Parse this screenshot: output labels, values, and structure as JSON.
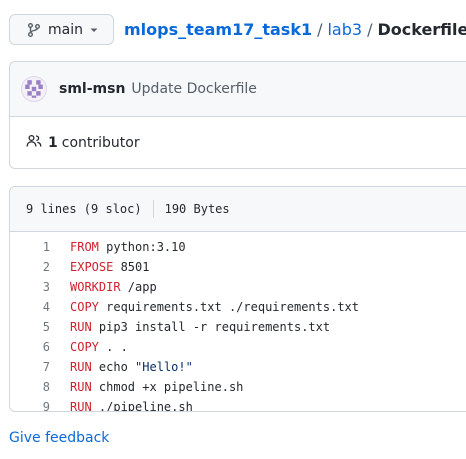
{
  "branch": {
    "name": "main",
    "icon": "git-branch-icon"
  },
  "breadcrumb": {
    "repo": "mlops_team17_task1",
    "separator": "/",
    "folder": "lab3",
    "file": "Dockerfile"
  },
  "commit": {
    "author": "sml-msn",
    "message": "Update Dockerfile"
  },
  "contributors": {
    "count": "1",
    "label": "contributor"
  },
  "file_info": {
    "lines": "9 lines (9 sloc)",
    "size": "190 Bytes"
  },
  "code_lines": [
    {
      "num": "1",
      "keyword": "FROM",
      "rest": " python:3.10",
      "string": ""
    },
    {
      "num": "2",
      "keyword": "EXPOSE",
      "rest": " 8501",
      "string": ""
    },
    {
      "num": "3",
      "keyword": "WORKDIR",
      "rest": " /app",
      "string": ""
    },
    {
      "num": "4",
      "keyword": "COPY",
      "rest": " requirements.txt ./requirements.txt",
      "string": ""
    },
    {
      "num": "5",
      "keyword": "RUN",
      "rest": " pip3 install -r requirements.txt",
      "string": ""
    },
    {
      "num": "6",
      "keyword": "COPY",
      "rest": " . .",
      "string": ""
    },
    {
      "num": "7",
      "keyword": "RUN",
      "rest": " echo ",
      "string": "\"Hello!\""
    },
    {
      "num": "8",
      "keyword": "RUN",
      "rest": " chmod +x pipeline.sh",
      "string": ""
    },
    {
      "num": "9",
      "keyword": "RUN",
      "rest": " ./pipeline.sh",
      "string": ""
    }
  ],
  "footer": {
    "feedback": "Give feedback"
  },
  "colors": {
    "link": "#0969da",
    "keyword": "#cf222e",
    "string": "#0a3069",
    "border": "#d0d7de"
  }
}
